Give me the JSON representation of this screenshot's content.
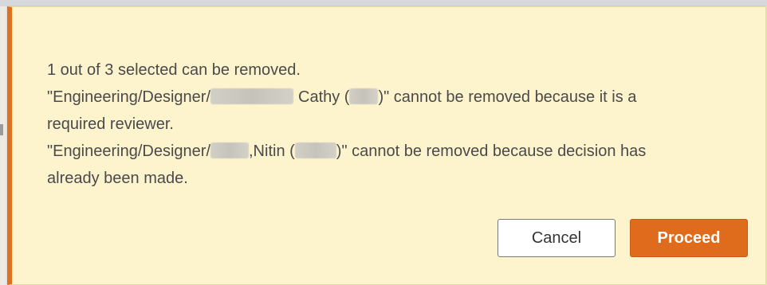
{
  "dialog": {
    "summary": "1 out of 3 selected can be removed.",
    "item1": {
      "prefix": "\"Engineering/Designer/",
      "name": "Cathy (",
      "suffix": ")\" cannot be removed because it is a",
      "continuation": "required reviewer."
    },
    "item2": {
      "prefix": "\"Engineering/Designer/",
      "name": ",Nitin (",
      "suffix": ")\" cannot be removed because decision has",
      "continuation": "already been made."
    },
    "buttons": {
      "cancel": "Cancel",
      "proceed": "Proceed"
    }
  },
  "colors": {
    "accent": "#e06f1f",
    "dialog_background": "#fdf3cd",
    "proceed_button": "#df6b1d"
  }
}
